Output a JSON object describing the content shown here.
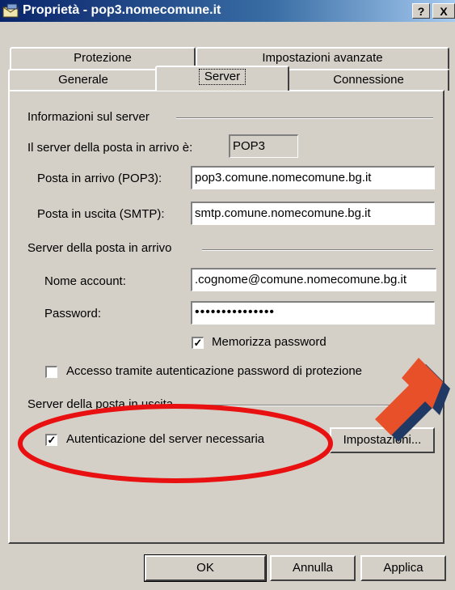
{
  "window": {
    "title": "Proprietà - pop3.nomecomune.it",
    "help_button": "?",
    "close_button": "X"
  },
  "tabs": {
    "row1": [
      "Protezione",
      "Impostazioni avanzate"
    ],
    "row2": [
      "Generale",
      "Server",
      "Connessione"
    ],
    "active": "Server"
  },
  "server_info": {
    "group_label": "Informazioni sul server",
    "incoming_type_label": "Il server della posta in arrivo è:",
    "incoming_type_value": "POP3",
    "incoming_label": "Posta in arrivo (POP3):",
    "incoming_value": "pop3.comune.nomecomune.bg.it",
    "outgoing_label": "Posta in uscita (SMTP):",
    "outgoing_value": "smtp.comune.nomecomune.bg.it"
  },
  "incoming_server": {
    "group_label": "Server della posta in arrivo",
    "account_label": "Nome account:",
    "account_value": ".cognome@comune.nomecomune.bg.it",
    "password_label": "Password:",
    "password_value": "•••••••••••••••",
    "remember_label": "Memorizza password",
    "remember_checked": true,
    "spa_label": "Accesso tramite autenticazione password di protezione",
    "spa_checked": false
  },
  "outgoing_server": {
    "group_label": "Server della posta in uscita",
    "auth_label": "Autenticazione del server necessaria",
    "auth_checked": true,
    "settings_button": "Impostazioni..."
  },
  "footer": {
    "ok": "OK",
    "cancel": "Annulla",
    "apply": "Applica"
  },
  "annotations": {
    "ellipse_color": "#e81010",
    "arrow_color": "#e8502a",
    "arrow_shadow": "#1f3864"
  }
}
